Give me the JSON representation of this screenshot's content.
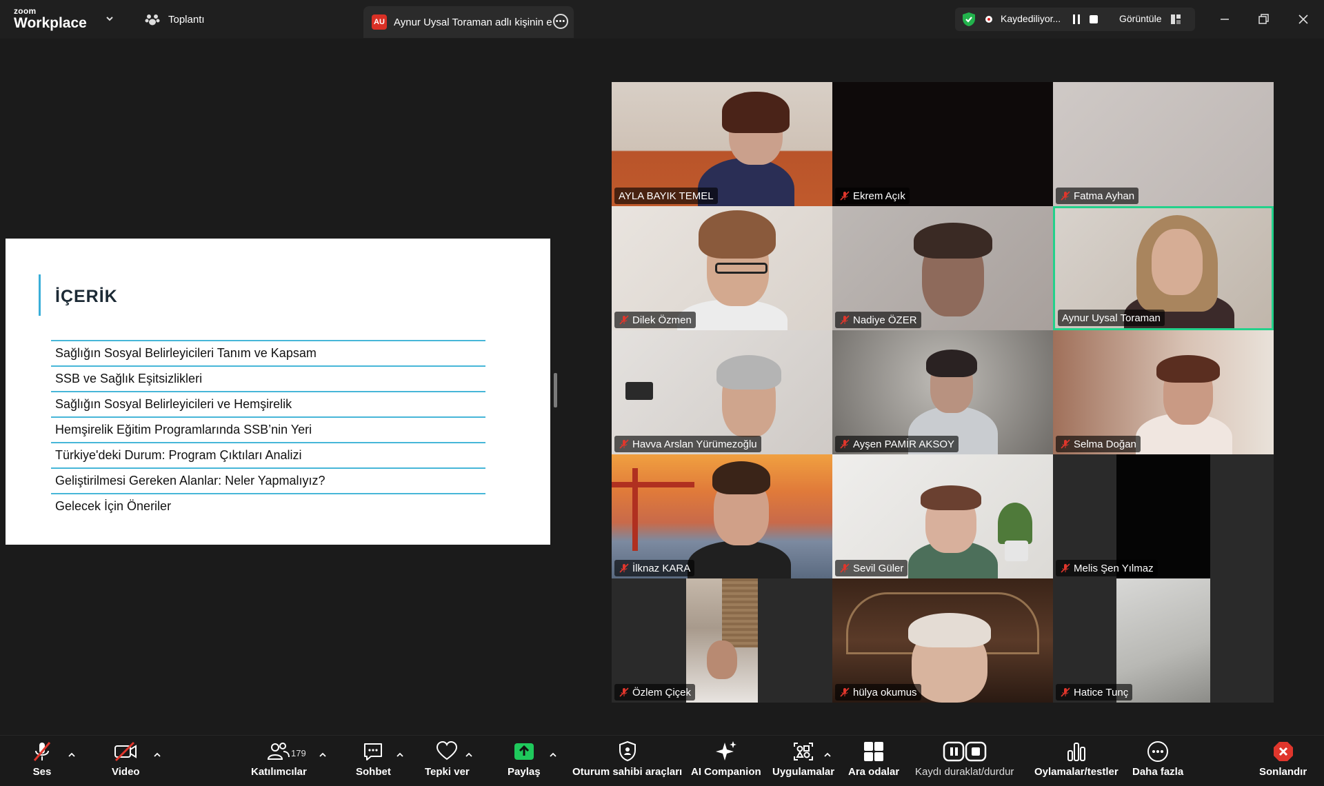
{
  "app": {
    "logo_small": "zoom",
    "logo_big": "Workplace",
    "meeting_button": "Toplantı",
    "active_tab": "Aynur Uysal Toraman adlı kişinin e",
    "active_tab_badge": "AU"
  },
  "recording": {
    "status": "Kaydediliyor...",
    "view_label": "Görüntüle"
  },
  "slide": {
    "title": "İÇERİK",
    "items": [
      "Sağlığın Sosyal Belirleyicileri Tanım ve Kapsam",
      "SSB ve Sağlık Eşitsizlikleri",
      "Sağlığın Sosyal Belirleyicileri ve Hemşirelik",
      "Hemşirelik Eğitim Programlarında SSB’nin Yeri",
      "Türkiye'deki Durum: Program Çıktıları Analizi",
      "Geliştirilmesi Gereken Alanlar: Neler Yapmalıyız?",
      "Gelecek İçin Öneriler"
    ]
  },
  "participants": [
    {
      "name": "AYLA BAYIK TEMEL",
      "muted": false
    },
    {
      "name": "Ekrem Açık",
      "muted": true
    },
    {
      "name": "Fatma Ayhan",
      "muted": true
    },
    {
      "name": "Dilek Özmen",
      "muted": true
    },
    {
      "name": "Nadiye ÖZER",
      "muted": true
    },
    {
      "name": "Aynur Uysal Toraman",
      "muted": false,
      "speaking": true
    },
    {
      "name": "Havva Arslan Yürümezoğlu",
      "muted": true
    },
    {
      "name": "Ayşen PAMİR AKSOY",
      "muted": true
    },
    {
      "name": "Selma Doğan",
      "muted": true
    },
    {
      "name": "İlknaz KARA",
      "muted": true
    },
    {
      "name": "Sevil Güler",
      "muted": true
    },
    {
      "name": "Melis Şen Yılmaz",
      "muted": true
    },
    {
      "name": "Özlem Çiçek",
      "muted": true
    },
    {
      "name": "hülya okumus",
      "muted": true
    },
    {
      "name": "Hatice Tunç",
      "muted": true
    }
  ],
  "toolbar": {
    "audio": "Ses",
    "video": "Video",
    "participants": "Katılımcılar",
    "participant_count": "179",
    "chat": "Sohbet",
    "react": "Tepki ver",
    "share": "Paylaş",
    "host_tools": "Oturum sahibi araçları",
    "ai": "AI Companion",
    "apps": "Uygulamalar",
    "breakout": "Ara odalar",
    "record": "Kaydı duraklat/durdur",
    "polls": "Oylamalar/testler",
    "more": "Daha fazla",
    "end": "Sonlandır"
  },
  "colors": {
    "accent_green": "#23d18b",
    "share_green": "#1fc95c",
    "mute_red": "#e0362c",
    "slide_line": "#46b6d8"
  }
}
